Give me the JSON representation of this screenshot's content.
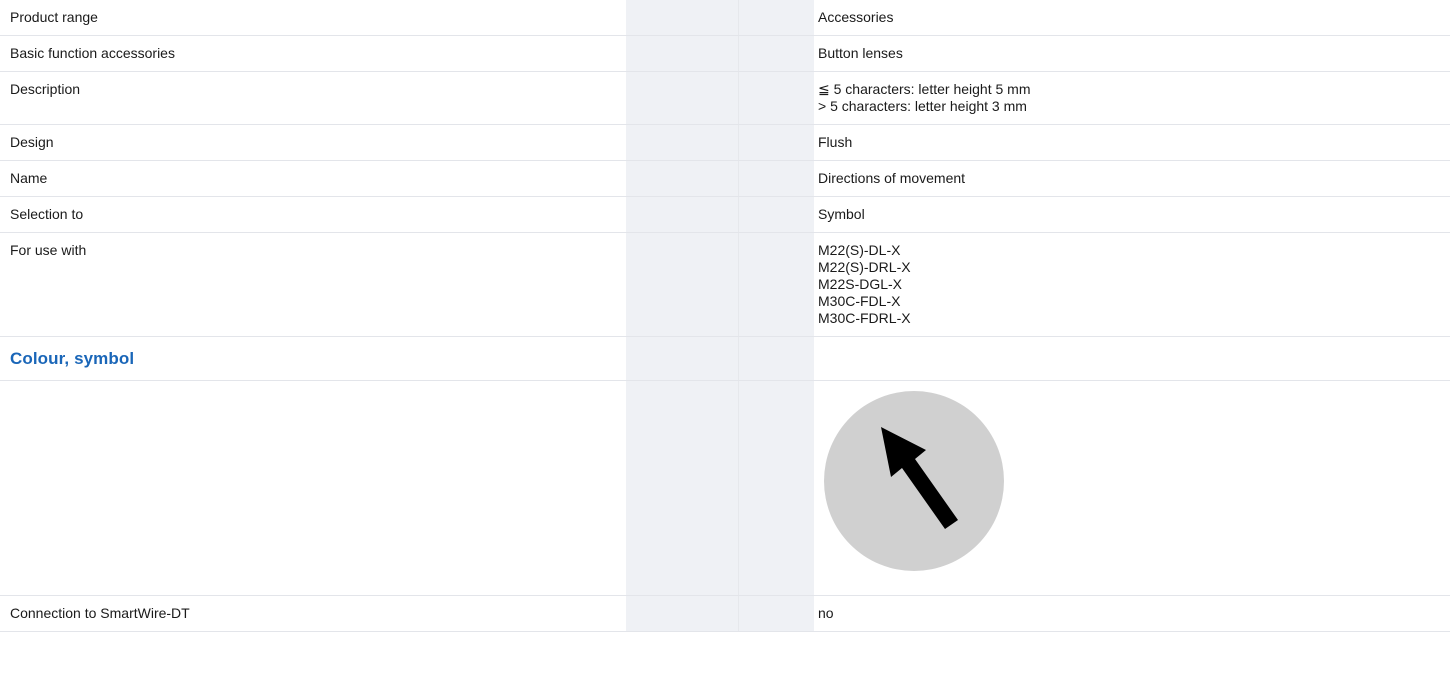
{
  "rows": [
    {
      "label": "Product range",
      "value": [
        "Accessories"
      ]
    },
    {
      "label": "Basic function accessories",
      "value": [
        "Button lenses"
      ]
    },
    {
      "label": "Description",
      "value": [
        "≦ 5 characters: letter height 5 mm",
        "> 5 characters: letter height 3 mm"
      ]
    },
    {
      "label": "Design",
      "value": [
        "Flush"
      ]
    },
    {
      "label": "Name",
      "value": [
        "Directions of movement"
      ]
    },
    {
      "label": "Selection to",
      "value": [
        "Symbol"
      ]
    },
    {
      "label": "For use with",
      "value": [
        "M22(S)-DL-X",
        "M22(S)-DRL-X",
        "M22S-DGL-X",
        "M30C-FDL-X",
        "M30C-FDRL-X"
      ]
    }
  ],
  "section": {
    "title": "Colour, symbol"
  },
  "symbol": {
    "icon": "arrow-up-left-icon",
    "circle_color": "#d0d0d0",
    "arrow_color": "#000000"
  },
  "footer_row": {
    "label": "Connection to SmartWire-DT",
    "value": "no"
  },
  "colors": {
    "section_title": "#1a66b8",
    "gap_column": "#eff1f5",
    "row_divider": "#e3e5ea"
  }
}
